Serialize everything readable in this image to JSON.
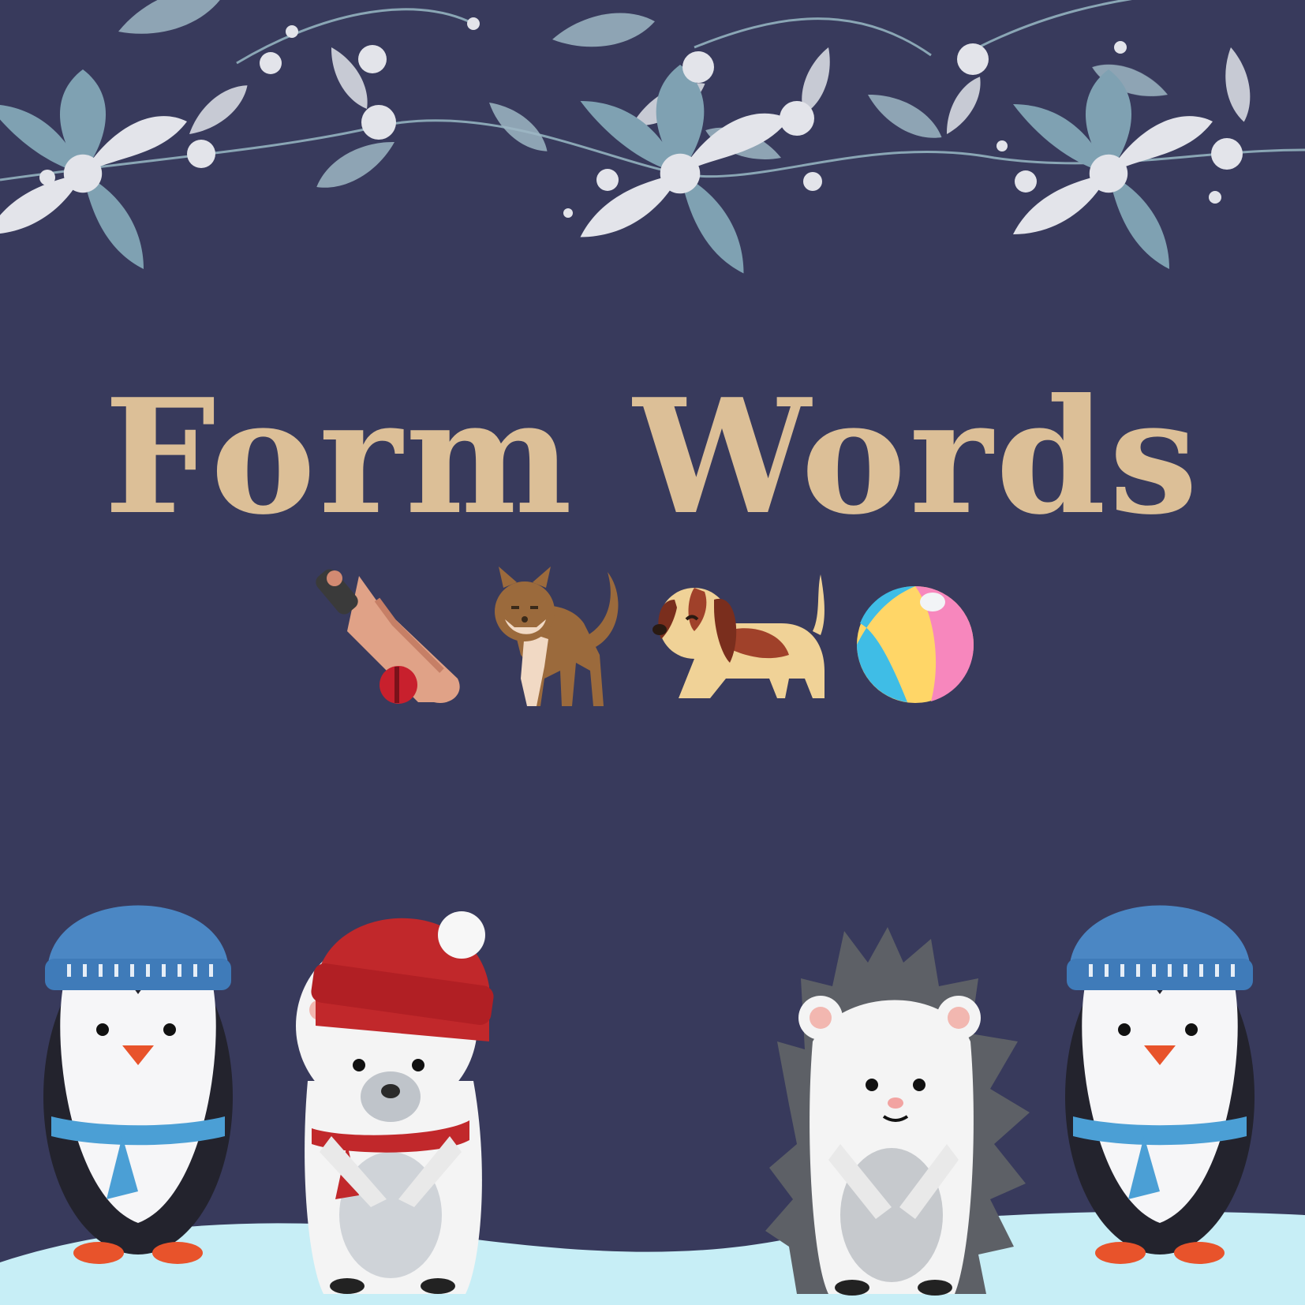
{
  "background_color": "#383a5c",
  "title": {
    "text": "Form Words",
    "color": "#dcbf97"
  },
  "picture_row": {
    "items": [
      {
        "name": "cricket-bat-and-ball-icon"
      },
      {
        "name": "cat-icon"
      },
      {
        "name": "dog-icon"
      },
      {
        "name": "beach-ball-icon"
      }
    ]
  },
  "decorations": {
    "top": "floral-garland",
    "bottom": [
      "penguin-with-blue-hat",
      "polar-bear-with-red-hat",
      "hedgehog",
      "penguin-with-blue-hat"
    ],
    "snow_color": "#c7eef6"
  }
}
